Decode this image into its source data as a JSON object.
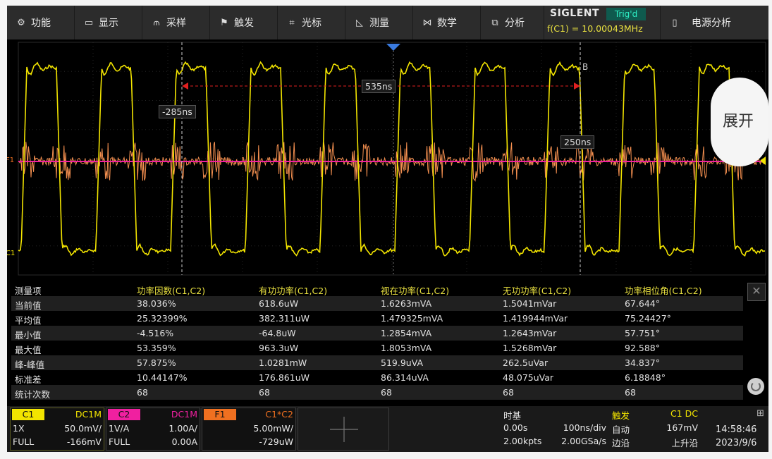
{
  "menu": {
    "items": [
      {
        "label": "功能",
        "icon": "gear-icon",
        "glyph": "⚙"
      },
      {
        "label": "显示",
        "icon": "display-icon",
        "glyph": "▭"
      },
      {
        "label": "采样",
        "icon": "acquire-icon",
        "glyph": "⫙"
      },
      {
        "label": "触发",
        "icon": "trigger-flag-icon",
        "glyph": "⚑"
      },
      {
        "label": "光标",
        "icon": "cursor-icon",
        "glyph": "⌗"
      },
      {
        "label": "测量",
        "icon": "measure-icon",
        "glyph": "◺"
      },
      {
        "label": "数学",
        "icon": "math-icon",
        "glyph": "⋈"
      },
      {
        "label": "分析",
        "icon": "analysis-icon",
        "glyph": "⧉"
      }
    ],
    "brand": "SIGLENT",
    "trigger_status": "Trig'd",
    "frequency": "f(C1) = 10.00043MHz",
    "power_analysis": {
      "label": "电源分析",
      "icon": "battery-icon",
      "glyph": "▯"
    }
  },
  "cursors": {
    "delta": "535ns",
    "a_time": "-285ns",
    "b_time": "250ns",
    "b_label": "B"
  },
  "channel_markers": {
    "f1": "F1",
    "c1": "C1"
  },
  "expand_button": "展开",
  "measurements": {
    "columns": [
      "测量项",
      "功率因数(C1,C2)",
      "有功功率(C1,C2)",
      "视在功率(C1,C2)",
      "无功功率(C1,C2)",
      "功率相位角(C1,C2)"
    ],
    "rows": [
      [
        "当前值",
        "38.036%",
        "618.6uW",
        "1.6263mVA",
        "1.5041mVar",
        "67.644°"
      ],
      [
        "平均值",
        "25.32399%",
        "382.311uW",
        "1.479325mVA",
        "1.419944mVar",
        "75.24427°"
      ],
      [
        "最小值",
        "-4.516%",
        "-64.8uW",
        "1.2854mVA",
        "1.2643mVar",
        "57.751°"
      ],
      [
        "最大值",
        "53.359%",
        "963.3uW",
        "1.8053mVA",
        "1.5268mVar",
        "92.588°"
      ],
      [
        "峰-峰值",
        "57.875%",
        "1.0281mW",
        "519.9uVA",
        "262.5uVar",
        "34.837°"
      ],
      [
        "标准差",
        "10.44147%",
        "176.861uW",
        "86.314uVA",
        "48.075uVar",
        "6.18848°"
      ],
      [
        "统计次数",
        "68",
        "68",
        "68",
        "68",
        "68"
      ]
    ]
  },
  "channels": {
    "c1": {
      "tag": "C1",
      "coupling": "DC1M",
      "probe": "1X",
      "scale": "50.0mV/",
      "bw": "FULL",
      "offset": "-166mV",
      "color": "#f2e400"
    },
    "c2": {
      "tag": "C2",
      "coupling": "DC1M",
      "probe": "1V/A",
      "scale": "1.00A/",
      "bw": "FULL",
      "offset": "0.00A",
      "color": "#f020a0"
    },
    "f1": {
      "tag": "F1",
      "formula": "C1*C2",
      "scale": "5.00mW/",
      "offset": "-729uW",
      "color": "#f07020"
    }
  },
  "timebase": {
    "title": "时基",
    "delay": "0.00s",
    "scale": "100ns/div",
    "memory": "2.00kpts",
    "sample_rate": "2.00GSa/s"
  },
  "trigger": {
    "title": "触发",
    "source": "C1 DC",
    "mode": "自动",
    "level": "167mV",
    "type": "边沿",
    "slope": "上升沿"
  },
  "clock": {
    "time": "14:58:46",
    "date": "2023/9/6",
    "icon": "network-icon"
  }
}
